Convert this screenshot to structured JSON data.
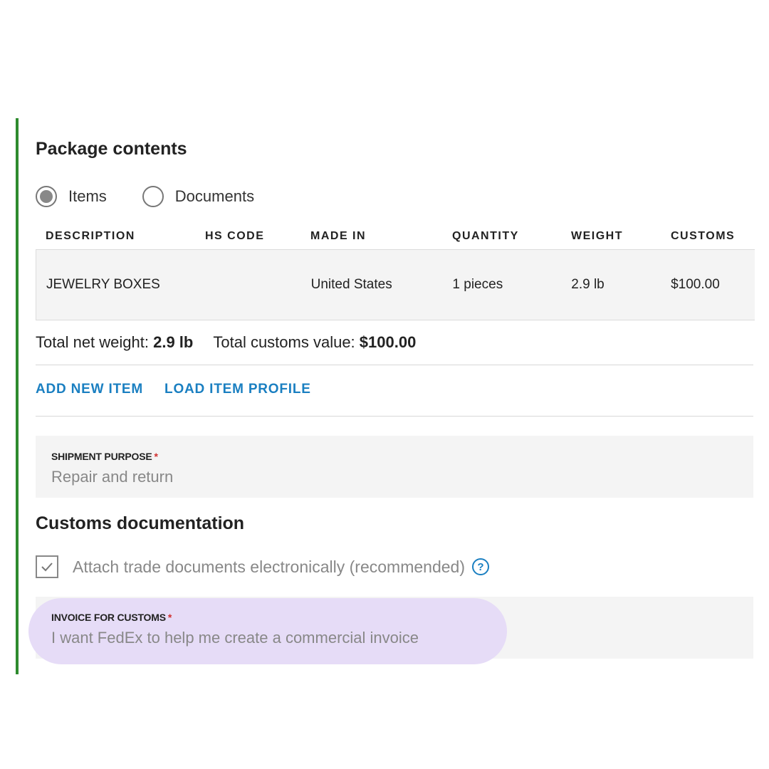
{
  "package_contents": {
    "title": "Package contents",
    "radio_options": [
      {
        "label": "Items",
        "selected": true
      },
      {
        "label": "Documents",
        "selected": false
      }
    ],
    "table": {
      "headers": [
        "DESCRIPTION",
        "HS CODE",
        "MADE IN",
        "QUANTITY",
        "WEIGHT",
        "CUSTOMS"
      ],
      "rows": [
        {
          "description": "JEWELRY BOXES",
          "hs_code": "",
          "made_in": "United States",
          "quantity": "1 pieces",
          "weight": "2.9 lb",
          "customs": "$100.00"
        }
      ]
    },
    "totals": {
      "net_weight_label": "Total net weight:",
      "net_weight_value": "2.9 lb",
      "customs_value_label": "Total customs value:",
      "customs_value_value": "$100.00"
    },
    "actions": {
      "add_new_item": "ADD NEW ITEM",
      "load_item_profile": "LOAD ITEM PROFILE"
    },
    "shipment_purpose": {
      "label": "SHIPMENT PURPOSE",
      "required_marker": "*",
      "value": "Repair and return"
    }
  },
  "customs_documentation": {
    "title": "Customs documentation",
    "attach_checkbox": {
      "label": "Attach trade documents electronically (recommended)",
      "checked": true,
      "help_icon": "?"
    },
    "invoice": {
      "label": "INVOICE FOR CUSTOMS",
      "required_marker": "*",
      "value": "I want FedEx to help me create a commercial invoice"
    }
  },
  "colors": {
    "accent_bar": "#2e8b2e",
    "link": "#1a7fc1",
    "highlight": "#e6dcf7",
    "required": "#d03030"
  }
}
